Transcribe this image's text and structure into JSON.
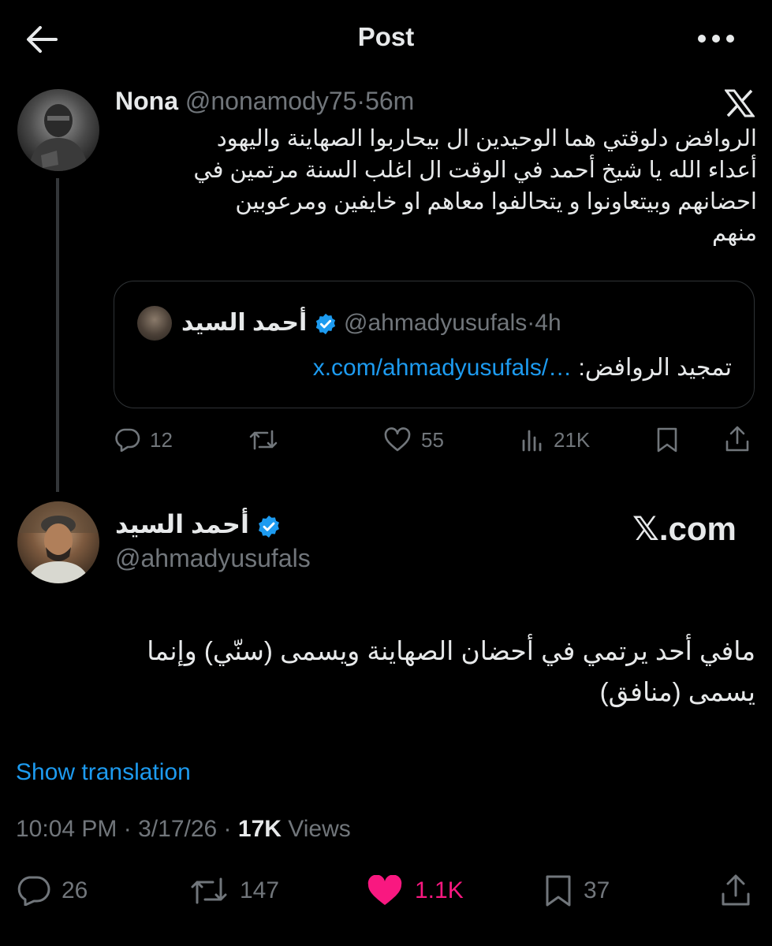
{
  "header": {
    "title": "Post",
    "back_icon": "arrow-left-icon",
    "more_icon": "more-horizontal-icon"
  },
  "parent_post": {
    "name": "Nona",
    "handle": "@nonamody75",
    "separator": "·",
    "time": "56m",
    "text_lines": [
      "الروافض دلوقتي هما الوحيدين ال بيحاربوا الصهاينة واليهود",
      "أعداء الله يا شيخ أحمد في الوقت ال اغلب السنة مرتمين في",
      "احضانهم وبيتعاونوا و يتحالفوا معاهم او خايفين ومرعوبين",
      "منهم"
    ],
    "quote": {
      "name": "أحمد السيد",
      "handle": "@ahmadyusufals",
      "separator": "·",
      "time": "4h",
      "text": "تمجيد الروافض:",
      "link": "x.com/ahmadyusufals/…"
    },
    "stats": {
      "replies": "12",
      "reposts": "",
      "likes": "55",
      "views": "21K"
    }
  },
  "main_post": {
    "name": "أحمد السيد",
    "handle": "@ahmadyusufals",
    "brand": "𝕏.com",
    "text_lines": [
      "مافي أحد يرتمي في أحضان الصهاينة ويسمى (سنّي) وإنما",
      "يسمى (منافق)"
    ],
    "show_translation": "Show translation",
    "time": "10:04 PM",
    "date": "3/17/26",
    "dot": "·",
    "views_count": "17K",
    "views_label": "Views",
    "stats": {
      "replies": "26",
      "reposts": "147",
      "likes": "1.1K",
      "bookmarks": "37"
    }
  },
  "colors": {
    "background": "#000000",
    "text": "#e7e9ea",
    "muted": "#71767b",
    "link": "#1d9bf0",
    "like": "#f91880",
    "verified": "#1d9bf0"
  }
}
